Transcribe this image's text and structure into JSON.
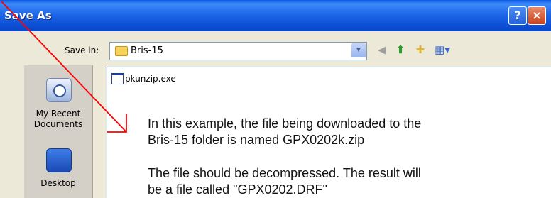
{
  "window": {
    "title": "Save As",
    "help_glyph": "?",
    "close_glyph": "×"
  },
  "toolbar": {
    "save_in_label": "Save in:",
    "save_in_value": "Bris-15",
    "icons": [
      "back-icon",
      "up-folder-icon",
      "new-folder-icon",
      "views-menu-icon"
    ]
  },
  "places": {
    "recent_label_line1": "My Recent",
    "recent_label_line2": "Documents",
    "desktop_label": "Desktop"
  },
  "files": {
    "items": [
      "pkunzip.exe"
    ]
  },
  "annotation": {
    "line1": "In this example, the file being downloaded to the",
    "line2": "Bris-15 folder is named GPX0202k.zip",
    "line3": "The file should be decompressed.  The result will",
    "line4": "be a file called \"GPX0202.DRF\"",
    "arrow_color": "#ff0000"
  }
}
